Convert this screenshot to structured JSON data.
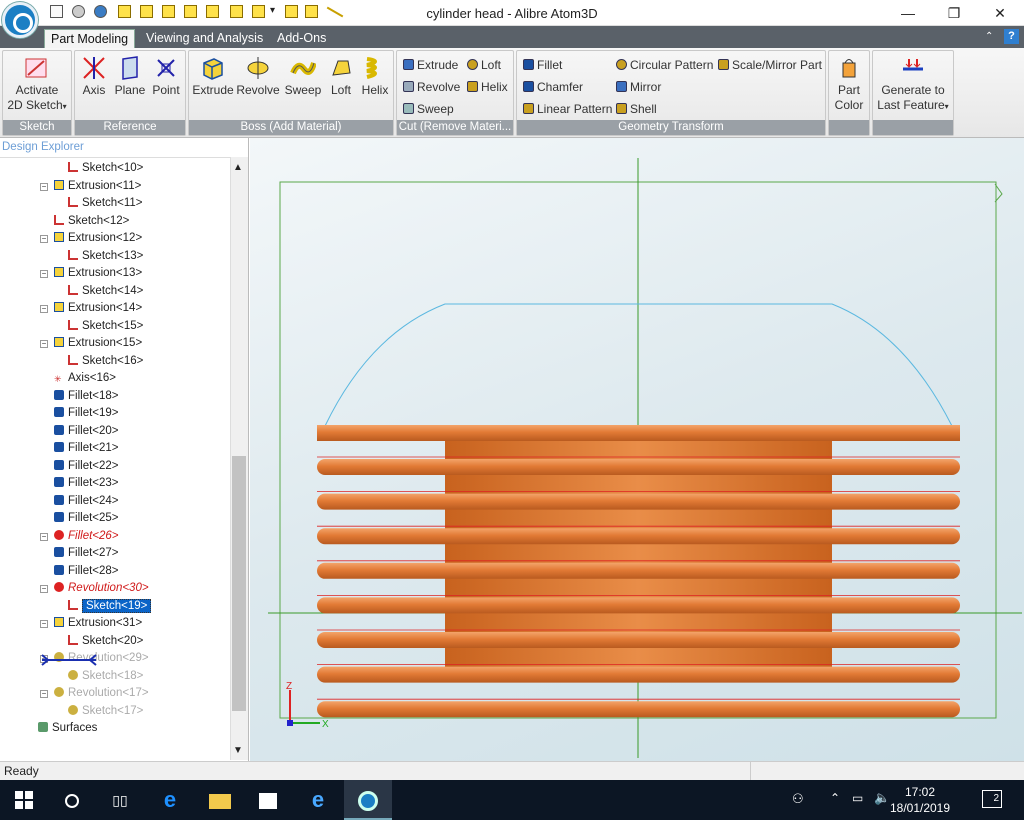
{
  "window": {
    "title": "cylinder head - Alibre Atom3D",
    "controls": {
      "min": "—",
      "max": "❐",
      "close": "✕"
    }
  },
  "tabs": [
    {
      "label": "Part Modeling"
    },
    {
      "label": "Viewing and Analysis"
    },
    {
      "label": "Add-Ons"
    }
  ],
  "ribbon": {
    "sketch": {
      "label": "Sketch",
      "activate_line1": "Activate",
      "activate_line2": "2D Sketch"
    },
    "reference": {
      "label": "Reference",
      "axis": "Axis",
      "plane": "Plane",
      "point": "Point"
    },
    "boss": {
      "label": "Boss (Add Material)",
      "extrude": "Extrude",
      "revolve": "Revolve",
      "sweep": "Sweep",
      "loft": "Loft",
      "helix": "Helix"
    },
    "cut": {
      "label": "Cut (Remove Materi...",
      "extrude": "Extrude",
      "loft": "Loft",
      "revolve": "Revolve",
      "helix": "Helix",
      "sweep": "Sweep"
    },
    "transform": {
      "label": "Geometry Transform",
      "fillet": "Fillet",
      "chamfer": "Chamfer",
      "linear_pattern": "Linear Pattern",
      "circular_pattern": "Circular Pattern",
      "mirror": "Mirror",
      "shell": "Shell",
      "scale_mirror": "Scale/Mirror Part"
    },
    "part_color": {
      "line1": "Part",
      "line2": "Color"
    },
    "generate": {
      "line1": "Generate to",
      "line2": "Last Feature"
    }
  },
  "explorer": {
    "title": "Design Explorer",
    "items": [
      {
        "label": "Sketch<10>",
        "type": "sketch"
      },
      {
        "label": "Extrusion<11>",
        "type": "extrusion"
      },
      {
        "label": "Sketch<11>",
        "type": "sketch"
      },
      {
        "label": "Sketch<12>",
        "type": "sketch"
      },
      {
        "label": "Extrusion<12>",
        "type": "extrusion"
      },
      {
        "label": "Sketch<13>",
        "type": "sketch"
      },
      {
        "label": "Extrusion<13>",
        "type": "extrusion"
      },
      {
        "label": "Sketch<14>",
        "type": "sketch"
      },
      {
        "label": "Extrusion<14>",
        "type": "extrusion"
      },
      {
        "label": "Sketch<15>",
        "type": "sketch"
      },
      {
        "label": "Extrusion<15>",
        "type": "extrusion"
      },
      {
        "label": "Sketch<16>",
        "type": "sketch"
      },
      {
        "label": "Axis<16>",
        "type": "axis"
      },
      {
        "label": "Fillet<18>",
        "type": "fillet"
      },
      {
        "label": "Fillet<19>",
        "type": "fillet"
      },
      {
        "label": "Fillet<20>",
        "type": "fillet"
      },
      {
        "label": "Fillet<21>",
        "type": "fillet"
      },
      {
        "label": "Fillet<22>",
        "type": "fillet"
      },
      {
        "label": "Fillet<23>",
        "type": "fillet"
      },
      {
        "label": "Fillet<24>",
        "type": "fillet"
      },
      {
        "label": "Fillet<25>",
        "type": "fillet"
      },
      {
        "label": "Fillet<26>",
        "type": "error"
      },
      {
        "label": "Fillet<27>",
        "type": "fillet"
      },
      {
        "label": "Fillet<28>",
        "type": "fillet"
      },
      {
        "label": "Revolution<30>",
        "type": "error"
      },
      {
        "label": "Sketch<19>",
        "type": "sketch-selected"
      },
      {
        "label": "Extrusion<31>",
        "type": "extrusion"
      },
      {
        "label": "Sketch<20>",
        "type": "sketch"
      },
      {
        "label": "Revolution<29>",
        "type": "suppressed"
      },
      {
        "label": "Sketch<18>",
        "type": "suppressed"
      },
      {
        "label": "Revolution<17>",
        "type": "suppressed"
      },
      {
        "label": "Sketch<17>",
        "type": "suppressed"
      },
      {
        "label": "Surfaces",
        "type": "surfaces"
      }
    ]
  },
  "viewport": {
    "axis_z": "Z",
    "axis_x": "X",
    "body_color": "#e77f36",
    "profile_color": "#5bb8e0",
    "fin_count": 8
  },
  "status": {
    "text": "Ready"
  },
  "taskbar": {
    "time": "17:02",
    "date": "18/01/2019",
    "notifications": "2"
  }
}
